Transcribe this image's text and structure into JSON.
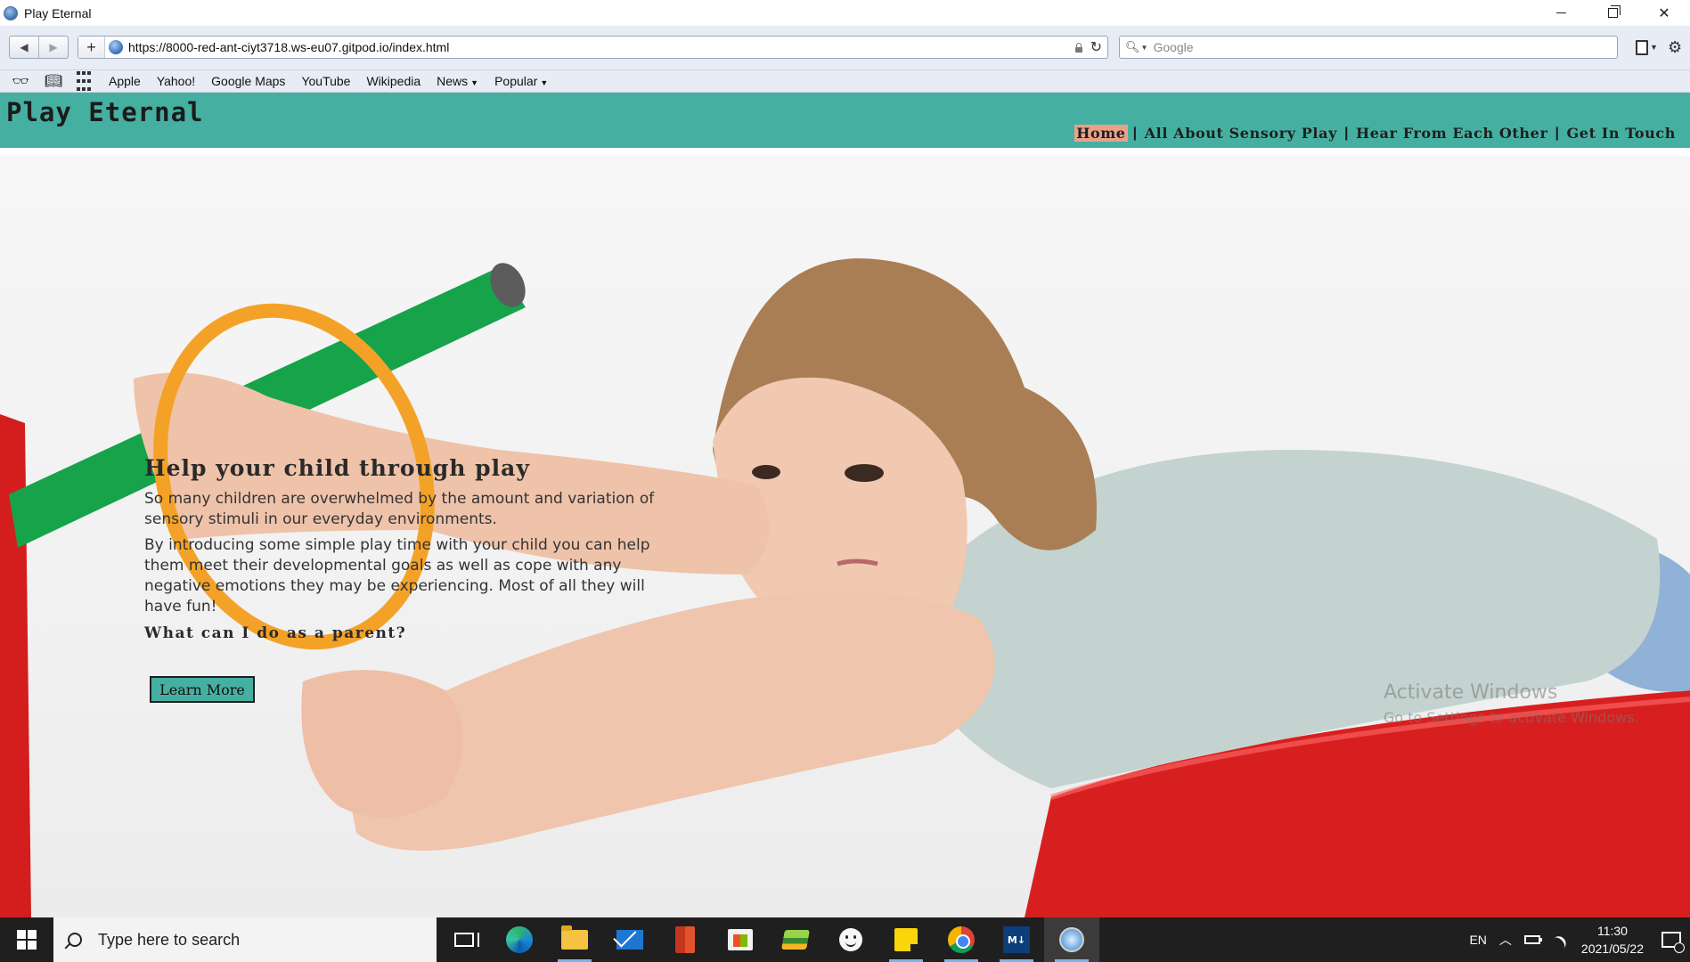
{
  "window": {
    "title": "Play Eternal"
  },
  "browser": {
    "back_icon": "back-arrow-icon",
    "forward_icon": "forward-arrow-icon",
    "url": "https://8000-red-ant-ciyt3718.ws-eu07.gitpod.io/index.html",
    "search_placeholder": "Google",
    "bookmarks": [
      {
        "label": "Apple"
      },
      {
        "label": "Yahoo!"
      },
      {
        "label": "Google Maps"
      },
      {
        "label": "YouTube"
      },
      {
        "label": "Wikipedia"
      },
      {
        "label": "News",
        "has_menu": true
      },
      {
        "label": "Popular",
        "has_menu": true
      }
    ]
  },
  "site": {
    "logo": "Play Eternal",
    "brand_color": "#45b0a2",
    "active_nav_color": "#e9a188",
    "nav": [
      {
        "label": "Home",
        "active": true
      },
      {
        "label": "All About Sensory Play",
        "active": false
      },
      {
        "label": "Hear From Each Other",
        "active": false
      },
      {
        "label": "Get In Touch",
        "active": false
      }
    ],
    "nav_separator": "|",
    "hero": {
      "title": "Help your child through play",
      "paragraph_1": "So many children are overwhelmed by the amount and variation of sensory stimuli in our everyday environments.",
      "paragraph_2": "By introducing some simple play time with your child you can help them meet their developmental goals as well as cope with any negative emotions they may be experiencing. Most of all they will have fun!",
      "subheading": "What can I do as a parent?",
      "button_label": "Learn More"
    }
  },
  "watermark": {
    "title": "Activate Windows",
    "subtitle": "Go to Settings to activate Windows."
  },
  "taskbar": {
    "search_placeholder": "Type here to search",
    "apps": [
      "task-view",
      "edge",
      "file-explorer",
      "mail",
      "office",
      "store",
      "bluestacks",
      "emoji-app",
      "sticky-notes",
      "chrome",
      "markdown-app",
      "safari"
    ],
    "language": "EN",
    "time": "11:30",
    "date": "2021/05/22",
    "notification_count": "1"
  }
}
